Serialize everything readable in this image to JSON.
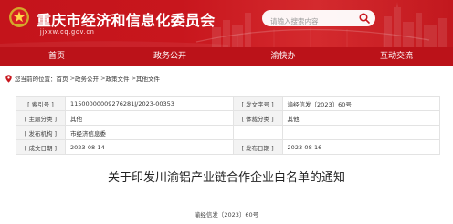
{
  "header": {
    "title": "重庆市经济和信息化委员会",
    "domain": "jjxxw.cq.gov.cn",
    "search_placeholder": "请输入搜索内容",
    "emblem_icon": "national-emblem",
    "search_icon": "magnifier-icon"
  },
  "nav": {
    "items": [
      "首页",
      "政务公开",
      "渝快办",
      "互动交流"
    ]
  },
  "breadcrumb": {
    "icon": "location-pin-icon",
    "prefix": "您当前的位置：",
    "separator": " >",
    "items": [
      "首页",
      "政务公开",
      "政策文件",
      "其他文件"
    ]
  },
  "meta": {
    "rows": [
      {
        "label": "[ 索引号 ]",
        "value": "11500000009276281J/2023-00353",
        "label2": "[ 发文字号 ]",
        "value2": "渝经信发〔2023〕60号"
      },
      {
        "label": "[ 主题分类 ]",
        "value": "其他",
        "label2": "[ 体裁分类 ]",
        "value2": "其他"
      },
      {
        "label": "[ 发布机构 ]",
        "value": "市经济信息委"
      },
      {
        "label": "[ 成文日期 ]",
        "value": "2023-08-14",
        "label2": "[ 发布日期 ]",
        "value2": "2023-08-16"
      }
    ]
  },
  "article": {
    "title": "关于印发川渝铝产业链合作企业白名单的通知",
    "doc_number": "渝经信发〔2023〕60号"
  },
  "theme": {
    "brand_red": "#c8161d",
    "nav_red": "#bb1219"
  }
}
